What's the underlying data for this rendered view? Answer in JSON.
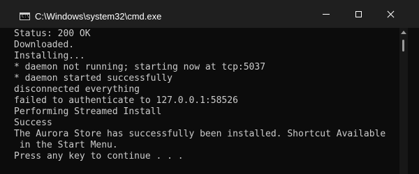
{
  "window": {
    "title": "C:\\Windows\\system32\\cmd.exe",
    "app_icon": "cmd-console-icon",
    "controls": {
      "minimize_icon": "minimize-icon",
      "maximize_icon": "maximize-icon",
      "close_icon": "close-icon"
    }
  },
  "console": {
    "lines": [
      "Status: 200 OK",
      "Downloaded.",
      "Installing...",
      "* daemon not running; starting now at tcp:5037",
      "* daemon started successfully",
      "disconnected everything",
      "failed to authenticate to 127.0.0.1:58526",
      "Performing Streamed Install",
      "Success",
      "The Aurora Store has successfully been installed. Shortcut Available",
      " in the Start Menu.",
      "Press any key to continue . . ."
    ],
    "colors": {
      "background": "#0c0c0c",
      "text": "#cccccc",
      "titlebar": "#1f1f1f"
    }
  }
}
